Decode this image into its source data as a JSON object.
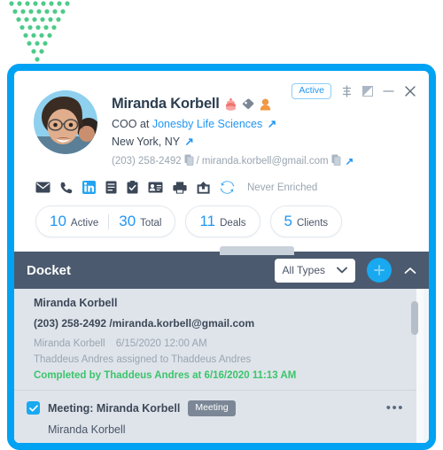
{
  "decor": {
    "dot_color": "#4ecb8a",
    "name": "green-dot-pattern"
  },
  "window": {
    "accent_color": "#00A2F3",
    "controls": {
      "status_badge": "Active",
      "settings_icon": "sliders-icon",
      "expand_icon": "expand-icon",
      "minimize_icon": "minimize-icon",
      "close_icon": "close-icon"
    }
  },
  "contact": {
    "avatar_alt": "avatar",
    "name": "Miranda Korbell",
    "name_icons": [
      "hot-lead-icon",
      "tag-icon",
      "person-icon"
    ],
    "title_prefix": "COO at",
    "company": "Jonesby Life Sciences",
    "location": "New York, NY",
    "phone": "(203) 258-2492",
    "email": "miranda.korbell@gmail.com",
    "separator": "/",
    "copy_icon": "copy-icon",
    "external_icon": "external-link-icon"
  },
  "actions": {
    "icons": [
      "email-icon",
      "phone-icon",
      "linkedin-icon",
      "note-icon",
      "task-icon",
      "contact-card-icon",
      "print-icon",
      "share-icon",
      "sync-icon"
    ],
    "enrich_status": "Never Enriched"
  },
  "stats": [
    {
      "num": "10",
      "label": "Active",
      "num2": "30",
      "label2": "Total"
    },
    {
      "num": "11",
      "label": "Deals"
    },
    {
      "num": "5",
      "label": "Clients"
    }
  ],
  "stats_flat": {
    "active_num": "10",
    "active_label": "Active",
    "total_num": "30",
    "total_label": "Total",
    "deals_num": "11",
    "deals_label": "Deals",
    "clients_num": "5",
    "clients_label": "Clients"
  },
  "docket": {
    "title": "Docket",
    "filter_value": "All Types",
    "filter_caret": "chevron-down-icon",
    "add_label": "+",
    "collapse_icon": "chevron-up-icon",
    "items": [
      {
        "name": "Miranda Korbell",
        "contact": "(203) 258-2492 /miranda.korbell@gmail.com",
        "meta_author": "Miranda Korbell",
        "meta_when": "6/15/2020 12:00 AM",
        "assignment": "Thaddeus Andres assigned to Thaddeus Andres",
        "completion": "Completed by  Thaddeus Andres at 6/16/2020 11:13 AM"
      },
      {
        "checked": true,
        "title": "Meeting: Miranda Korbell",
        "badge": "Meeting",
        "menu_icon": "kebab-menu-icon",
        "subtitle": "Miranda Korbell"
      }
    ]
  }
}
